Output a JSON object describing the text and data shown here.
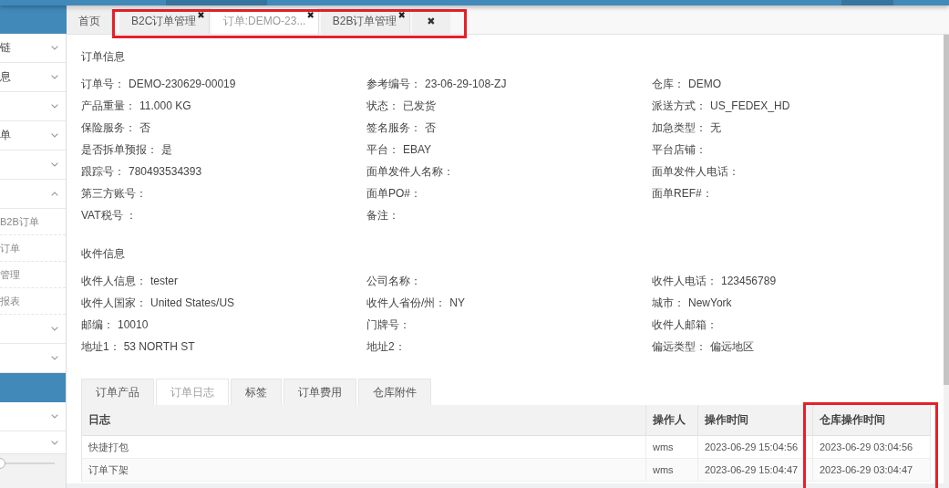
{
  "sidebar": {
    "items": [
      {
        "kind": "group",
        "label": "链",
        "expanded": false,
        "selected": false
      },
      {
        "kind": "group",
        "label": "息",
        "expanded": false,
        "selected": false
      },
      {
        "kind": "group",
        "expanded": false,
        "selected": false
      },
      {
        "kind": "group",
        "label": "单",
        "expanded": false,
        "selected": false
      },
      {
        "kind": "group",
        "expanded": false,
        "selected": false
      },
      {
        "kind": "group",
        "expanded": true,
        "selected": false,
        "children": [
          {
            "label": "B2B订单",
            "selected": false
          },
          {
            "label": "订单",
            "selected": false
          },
          {
            "label": "管理",
            "selected": false
          },
          {
            "label": "报表",
            "selected": false
          }
        ]
      },
      {
        "kind": "group",
        "expanded": false,
        "selected": false
      },
      {
        "kind": "group",
        "expanded": false,
        "selected": false
      },
      {
        "kind": "link",
        "selected": true
      },
      {
        "kind": "group",
        "expanded": false,
        "selected": false
      },
      {
        "kind": "group",
        "expanded": false,
        "selected": false
      }
    ],
    "slider": {
      "level": 0
    }
  },
  "tab_bar": {
    "tabs": [
      {
        "label": "首页",
        "selected": false,
        "highlighted": false
      },
      {
        "label": "B2C订单管理",
        "close": "✖",
        "selected": false,
        "highlighted": true
      },
      {
        "label": "订单:DEMO-23...",
        "close": "✖",
        "selected": true,
        "highlighted": true
      },
      {
        "label": "B2B订单管理",
        "close": "✖",
        "selected": false,
        "highlighted": true
      }
    ],
    "close_all": {
      "label": "✖",
      "highlighted": true
    }
  },
  "order_info": {
    "title": "订单信息",
    "fields": [
      {
        "label": "订单号：",
        "value": "DEMO-230629-00019"
      },
      {
        "label": "参考编号：",
        "value": "23-06-29-108-ZJ"
      },
      {
        "label": "仓库：",
        "value": "DEMO"
      },
      {
        "label": "产品重量：",
        "value": "11.000 KG"
      },
      {
        "label": "状态：",
        "value": "已发货"
      },
      {
        "label": "派送方式：",
        "value": "US_FEDEX_HD"
      },
      {
        "label": "保险服务：",
        "value": "否"
      },
      {
        "label": "签名服务：",
        "value": "否"
      },
      {
        "label": "加急类型：",
        "value": "无"
      },
      {
        "label": "是否拆单预报：",
        "value": "是"
      },
      {
        "label": "平台：",
        "value": "EBAY"
      },
      {
        "label": "平台店铺："
      },
      {
        "label": "跟踪号：",
        "value": "780493534393"
      },
      {
        "label": "面单发件人名称："
      },
      {
        "label": "面单发件人电话："
      },
      {
        "label": "第三方账号："
      },
      {
        "label": "面单PO#："
      },
      {
        "label": "面单REF#："
      },
      {
        "label": "VAT税号 ："
      },
      {
        "label": "备注："
      }
    ]
  },
  "recipient_info": {
    "title": "收件信息",
    "fields": [
      {
        "label": "收件人信息：",
        "value": "tester"
      },
      {
        "label": "公司名称："
      },
      {
        "label": "收件人电话：",
        "value": "123456789"
      },
      {
        "label": "收件人国家：",
        "value": "United States/US"
      },
      {
        "label": "收件人省份/州：",
        "value": "NY"
      },
      {
        "label": "城市：",
        "value": "NewYork"
      },
      {
        "label": "邮编：",
        "value": "10010"
      },
      {
        "label": "门牌号："
      },
      {
        "label": "收件人邮箱："
      },
      {
        "label": "地址1：",
        "value": "53 NORTH ST"
      },
      {
        "label": "地址2："
      },
      {
        "label": "偏远类型：",
        "value": "偏远地区"
      }
    ]
  },
  "detail_tabs": [
    {
      "label": "订单产品",
      "selected": false
    },
    {
      "label": "订单日志",
      "selected": true
    },
    {
      "label": "标签",
      "selected": false
    },
    {
      "label": "订单费用",
      "selected": false
    },
    {
      "label": "仓库附件",
      "selected": false
    }
  ],
  "log_table": {
    "columns": [
      {
        "label": "日志",
        "highlighted": false
      },
      {
        "label": "操作人",
        "highlighted": false
      },
      {
        "label": "操作时间",
        "highlighted": false
      },
      {
        "label": "仓库操作时间",
        "highlighted": true
      }
    ],
    "rows": [
      [
        "快捷打包",
        "wms",
        "2023-06-29 15:04:56",
        "2023-06-29 03:04:56"
      ],
      [
        "订单下架",
        "wms",
        "2023-06-29 15:04:47",
        "2023-06-29 03:04:47"
      ]
    ]
  }
}
